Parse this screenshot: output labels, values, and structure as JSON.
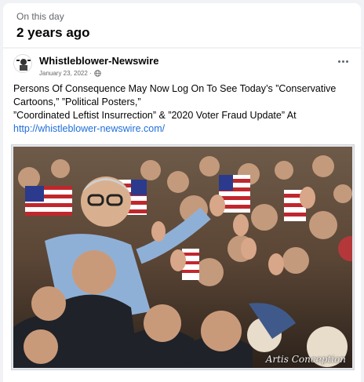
{
  "memory": {
    "label": "On this day",
    "title": "2 years ago"
  },
  "post": {
    "author": "Whistleblower-Newswire",
    "date": "January 23, 2022 ·",
    "privacy_icon": "globe-icon",
    "more_icon": "more-horizontal-icon",
    "text_lines": [
      "Persons Of Consequence May Now Log On To See Today’s ”Conservative",
      "Cartoons,” ”Political Posters,”",
      "”Coordinated Leftist Insurrection” & ”2020 Voter Fraud Update” At"
    ],
    "link": "http://whistleblower-newswire.com/",
    "image": {
      "description_icon": "crowd-photo",
      "watermark": "Artis Conception"
    }
  },
  "colors": {
    "background": "#f0f2f5",
    "link": "#216fdb",
    "secondary_text": "#65676b"
  }
}
